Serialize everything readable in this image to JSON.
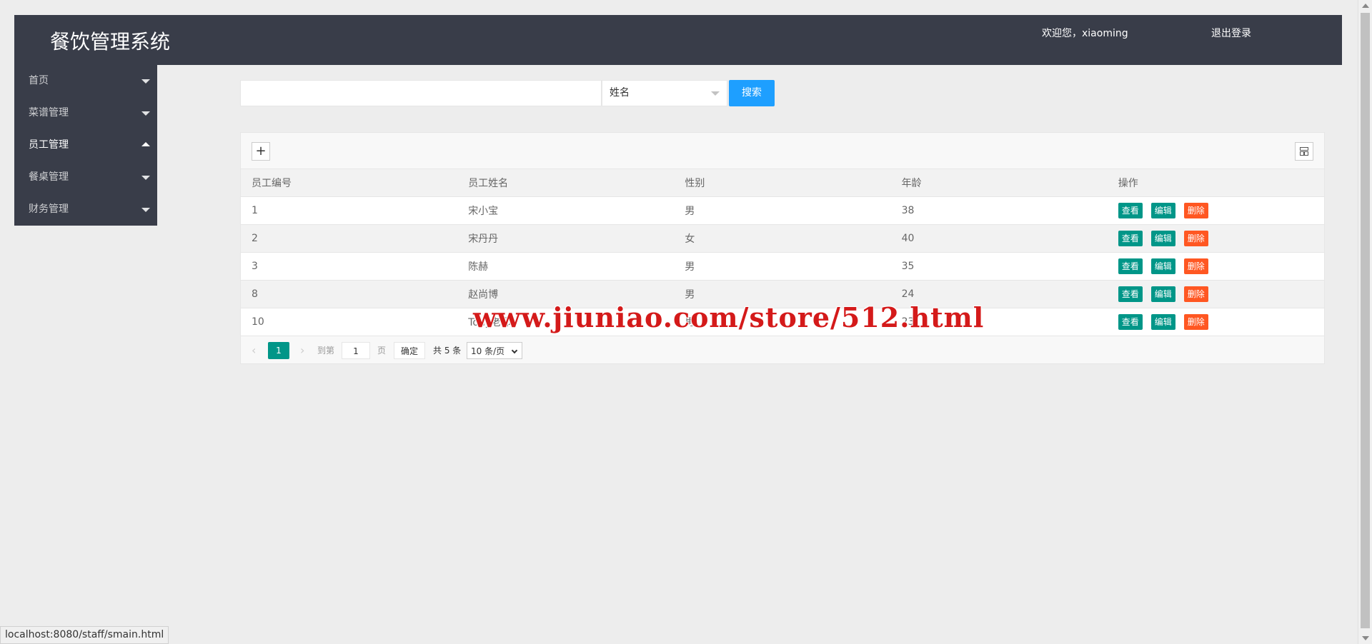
{
  "header": {
    "title": "餐饮管理系统",
    "welcome": "欢迎您，xiaoming",
    "logout": "退出登录"
  },
  "sidebar": {
    "items": [
      {
        "label": "首页",
        "expanded": false
      },
      {
        "label": "菜谱管理",
        "expanded": false
      },
      {
        "label": "员工管理",
        "expanded": true
      },
      {
        "label": "餐桌管理",
        "expanded": false
      },
      {
        "label": "财务管理",
        "expanded": false
      }
    ]
  },
  "search": {
    "value": "",
    "field_selected": "姓名",
    "button": "搜索"
  },
  "toolbar": {
    "add_icon": "plus-icon",
    "columns_icon": "columns-icon"
  },
  "table": {
    "headers": [
      "员工编号",
      "员工姓名",
      "性别",
      "年龄",
      "操作"
    ],
    "rows": [
      {
        "id": "1",
        "name": "宋小宝",
        "gender": "男",
        "age": "38"
      },
      {
        "id": "2",
        "name": "宋丹丹",
        "gender": "女",
        "age": "40"
      },
      {
        "id": "3",
        "name": "陈赫",
        "gender": "男",
        "age": "35"
      },
      {
        "id": "8",
        "name": "赵尚博",
        "gender": "男",
        "age": "24"
      },
      {
        "id": "10",
        "name": "Tony老师",
        "gender": "男",
        "age": "23"
      }
    ],
    "actions": {
      "view": "查看",
      "edit": "编辑",
      "delete": "删除"
    }
  },
  "pager": {
    "current": "1",
    "goto_label": "到第",
    "goto_value": "1",
    "page_unit": "页",
    "ok": "确定",
    "total": "共 5 条",
    "page_size": "10 条/页"
  },
  "watermark": "www.jiuniao.com/store/512.html",
  "status_bar": "localhost:8080/staff/smain.html",
  "colors": {
    "header_bg": "#393d49",
    "search_button": "#1e9fff",
    "primary": "#009688",
    "danger": "#ff5722"
  }
}
